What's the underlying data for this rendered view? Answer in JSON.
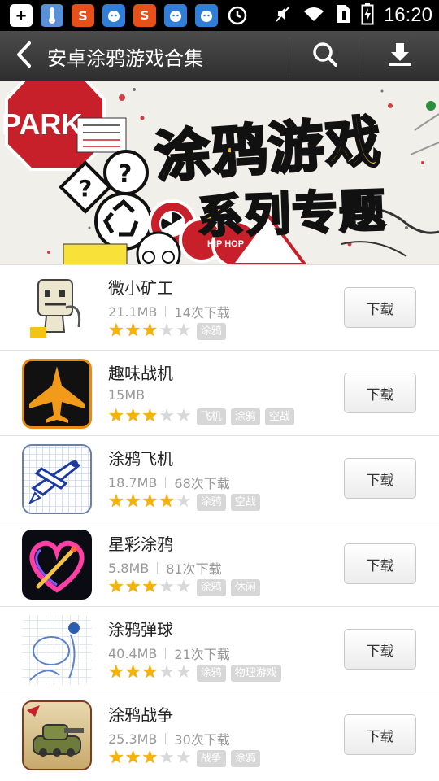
{
  "status_bar": {
    "time": "16:20",
    "left_icons": [
      "add-icon",
      "thermometer-icon",
      "sogou-icon",
      "android-app-icon",
      "store-icon",
      "android-app-icon",
      "android-app-icon",
      "sync-icon"
    ],
    "right_icons": [
      "mute-icon",
      "wifi-icon",
      "sim-icon",
      "battery-charging-icon"
    ]
  },
  "header": {
    "title": "安卓涂鸦游戏合集",
    "back_icon": "chevron-left-icon",
    "search_icon": "search-icon",
    "download_icon": "download-icon"
  },
  "banner": {
    "title_line1": "涂鸦游戏",
    "title_line2": "系列专题",
    "park_sign": "PARK",
    "hip_hop": "HIP HOP"
  },
  "colors": {
    "title_bar": "#3b3b3b",
    "star_on": "#f5b400",
    "star_off": "#d8d8d8",
    "tag_bg": "#d7d7d7",
    "banner_yellow": "#f8c215"
  },
  "download_label": "下载",
  "apps": [
    {
      "name": "微小矿工",
      "size": "21.1MB",
      "downloads": "14次下载",
      "rating": 3,
      "tags": [
        "涂鸦"
      ]
    },
    {
      "name": "趣味战机",
      "size": "15MB",
      "downloads": "",
      "rating": 3,
      "tags": [
        "飞机",
        "涂鸦",
        "空战"
      ]
    },
    {
      "name": "涂鸦飞机",
      "size": "18.7MB",
      "downloads": "68次下载",
      "rating": 4,
      "tags": [
        "涂鸦",
        "空战"
      ]
    },
    {
      "name": "星彩涂鸦",
      "size": "5.8MB",
      "downloads": "81次下载",
      "rating": 3,
      "tags": [
        "涂鸦",
        "休闲"
      ]
    },
    {
      "name": "涂鸦弹球",
      "size": "40.4MB",
      "downloads": "21次下载",
      "rating": 3,
      "tags": [
        "涂鸦",
        "物理游戏"
      ]
    },
    {
      "name": "涂鸦战争",
      "size": "25.3MB",
      "downloads": "30次下载",
      "rating": 3,
      "tags": [
        "战争",
        "涂鸦"
      ]
    }
  ]
}
